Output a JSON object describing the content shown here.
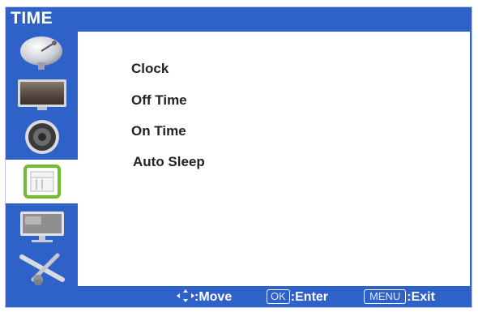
{
  "window": {
    "title": "TIME"
  },
  "sidebar": {
    "items": [
      {
        "name": "satellite-dish-icon",
        "active": false
      },
      {
        "name": "picture-icon",
        "active": false
      },
      {
        "name": "speaker-icon",
        "active": false
      },
      {
        "name": "clock-calendar-icon",
        "active": true
      },
      {
        "name": "monitor-setup-icon",
        "active": false
      },
      {
        "name": "tools-icon",
        "active": false
      }
    ]
  },
  "menu": {
    "items": [
      {
        "label": "Clock"
      },
      {
        "label": "Off Time"
      },
      {
        "label": "On Time"
      },
      {
        "label": "Auto Sleep"
      }
    ]
  },
  "footer": {
    "move_label": ":Move",
    "ok_key": "OK",
    "enter_label": ":Enter",
    "menu_key": "MENU",
    "exit_label": ":Exit"
  },
  "colors": {
    "frame_blue": "#2f62c8",
    "selection_green": "#6fbe2d",
    "content_bg": "#ffffff"
  }
}
